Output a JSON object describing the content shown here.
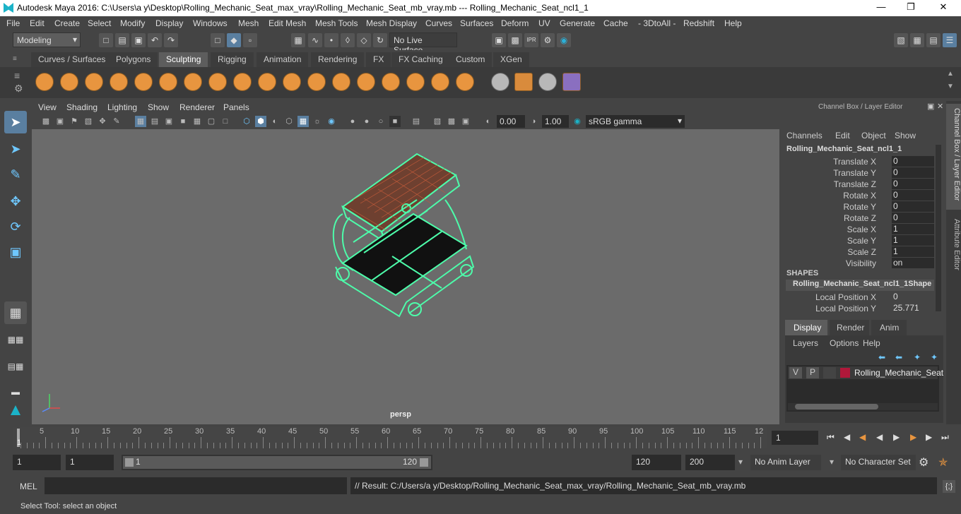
{
  "window": {
    "title": "Autodesk Maya 2016: C:\\Users\\a y\\Desktop\\Rolling_Mechanic_Seat_max_vray\\Rolling_Mechanic_Seat_mb_vray.mb  ---  Rolling_Mechanic_Seat_ncl1_1"
  },
  "menu": [
    "File",
    "Edit",
    "Create",
    "Select",
    "Modify",
    "Display",
    "Windows",
    "Mesh",
    "Edit Mesh",
    "Mesh Tools",
    "Mesh Display",
    "Curves",
    "Surfaces",
    "Deform",
    "UV",
    "Generate",
    "Cache",
    "- 3DtoAll -",
    "Redshift",
    "Help"
  ],
  "status": {
    "mode": "Modeling",
    "live_surface": "No Live Surface"
  },
  "shelf_tabs": [
    "Curves / Surfaces",
    "Polygons",
    "Sculpting",
    "Rigging",
    "Animation",
    "Rendering",
    "FX",
    "FX Caching",
    "Custom",
    "XGen"
  ],
  "active_shelf_tab": "Sculpting",
  "panel_menu": [
    "View",
    "Shading",
    "Lighting",
    "Show",
    "Renderer",
    "Panels"
  ],
  "viewport": {
    "exposure": "0.00",
    "gamma": "1.00",
    "color_space": "sRGB gamma",
    "camera": "persp"
  },
  "channel_box": {
    "header": "Channel Box / Layer Editor",
    "menu": [
      "Channels",
      "Edit",
      "Object",
      "Show"
    ],
    "object": "Rolling_Mechanic_Seat_ncl1_1",
    "channels": [
      {
        "label": "Translate X",
        "value": "0"
      },
      {
        "label": "Translate Y",
        "value": "0"
      },
      {
        "label": "Translate Z",
        "value": "0"
      },
      {
        "label": "Rotate X",
        "value": "0"
      },
      {
        "label": "Rotate Y",
        "value": "0"
      },
      {
        "label": "Rotate Z",
        "value": "0"
      },
      {
        "label": "Scale X",
        "value": "1"
      },
      {
        "label": "Scale Y",
        "value": "1"
      },
      {
        "label": "Scale Z",
        "value": "1"
      },
      {
        "label": "Visibility",
        "value": "on"
      }
    ],
    "shapes_header": "SHAPES",
    "shape_name": "Rolling_Mechanic_Seat_ncl1_1Shape",
    "shape_channels": [
      {
        "label": "Local Position X",
        "value": "0"
      },
      {
        "label": "Local Position Y",
        "value": "25.771"
      }
    ]
  },
  "layer_editor": {
    "tabs": [
      "Display",
      "Render",
      "Anim"
    ],
    "active_tab": "Display",
    "menu": [
      "Layers",
      "Options",
      "Help"
    ],
    "layer": {
      "v": "V",
      "p": "P",
      "name": "Rolling_Mechanic_Seat",
      "color": "#b0183a"
    }
  },
  "side_tabs": [
    "Channel Box / Layer Editor",
    "Attribute Editor"
  ],
  "timeline": {
    "ticks": [
      "5",
      "10",
      "15",
      "20",
      "25",
      "30",
      "35",
      "40",
      "45",
      "50",
      "55",
      "60",
      "65",
      "70",
      "75",
      "80",
      "85",
      "90",
      "95",
      "100",
      "105",
      "110",
      "115",
      "12"
    ],
    "start_marker": "1",
    "current_frame": "1"
  },
  "range": {
    "start": "1",
    "playback_start": "1",
    "slider_start": "1",
    "slider_end": "120",
    "playback_end": "120",
    "end": "200",
    "anim_layer": "No Anim Layer",
    "char_set": "No Character Set"
  },
  "command": {
    "label": "MEL",
    "result": "// Result: C:/Users/a y/Desktop/Rolling_Mechanic_Seat_max_vray/Rolling_Mechanic_Seat_mb_vray.mb"
  },
  "help_line": "Select Tool: select an object",
  "colors": {
    "wireframe": "#4dfcaa",
    "seat": "#b5492f",
    "viewport_bg": "#6b6b6b"
  }
}
